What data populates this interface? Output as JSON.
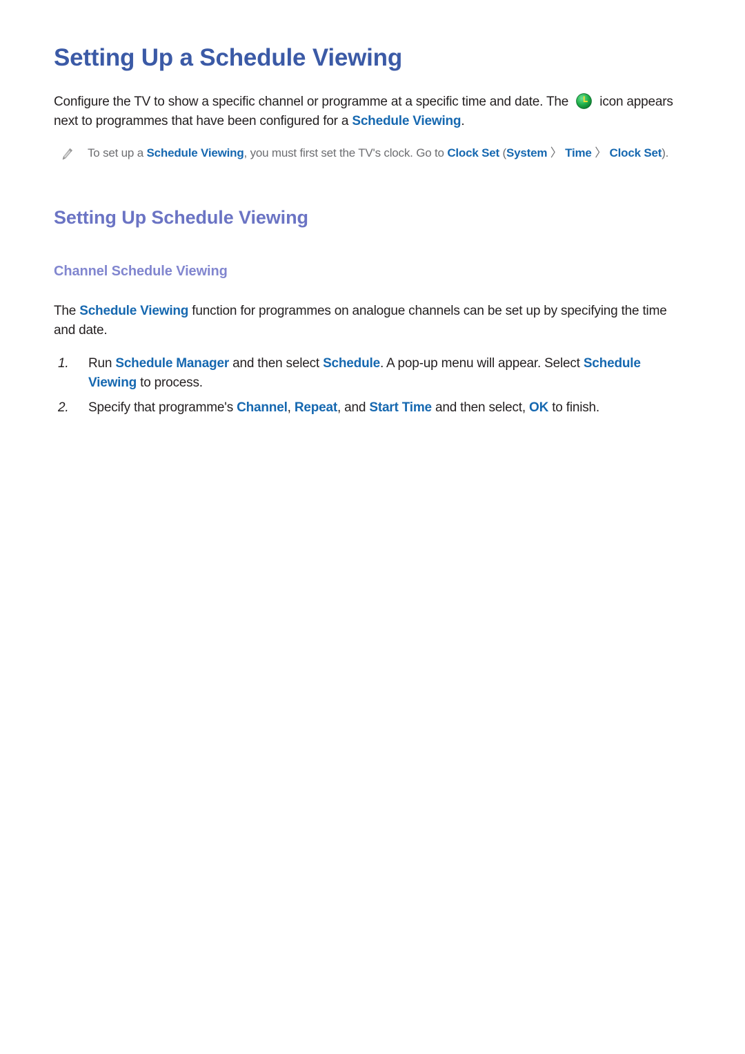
{
  "page": {
    "title": "Setting Up a Schedule Viewing"
  },
  "intro": {
    "part1": "Configure the TV to show a specific channel or programme at a specific time and date. The ",
    "clock_icon_name": "clock-icon",
    "part2": " icon appears next to programmes that have been configured for a ",
    "highlight1": "Schedule Viewing",
    "part3": "."
  },
  "note": {
    "icon_name": "pencil-icon",
    "part1": "To set up a ",
    "highlight1": "Schedule Viewing",
    "part2": ", you must first set the TV's clock. Go to ",
    "highlight2": "Clock Set",
    "part3": " (",
    "highlight3": "System",
    "sep1": " 〉 ",
    "highlight4": "Time",
    "sep2": " 〉 ",
    "highlight5": "Clock Set",
    "part4": ")."
  },
  "section": {
    "title": "Setting Up Schedule Viewing"
  },
  "subsection": {
    "title": "Channel Schedule Viewing",
    "lead_part1": "The ",
    "lead_highlight1": "Schedule Viewing",
    "lead_part2": " function for programmes on analogue channels can be set up by specifying the time and date."
  },
  "steps": [
    {
      "number": "1.",
      "part1": "Run ",
      "highlight1": "Schedule Manager",
      "part2": " and then select ",
      "highlight2": "Schedule",
      "part3": ". A pop-up menu will appear. Select ",
      "highlight3": "Schedule Viewing",
      "part4": " to process."
    },
    {
      "number": "2.",
      "part1": "Specify that programme's ",
      "highlight1": "Channel",
      "part2": ", ",
      "highlight2": "Repeat",
      "part3": ", and ",
      "highlight3": "Start Time",
      "part4": " and then select, ",
      "highlight4": "OK",
      "part5": " to finish."
    }
  ],
  "colors": {
    "title_blue": "#3b5aa6",
    "section_purple": "#6b74c4",
    "subsection_purple": "#8186cf",
    "highlight_blue": "#1668b0",
    "body_black": "#231f20",
    "note_gray": "#6d6e71",
    "clock_green": "#22b14c",
    "clock_yellow": "#f7e034"
  }
}
